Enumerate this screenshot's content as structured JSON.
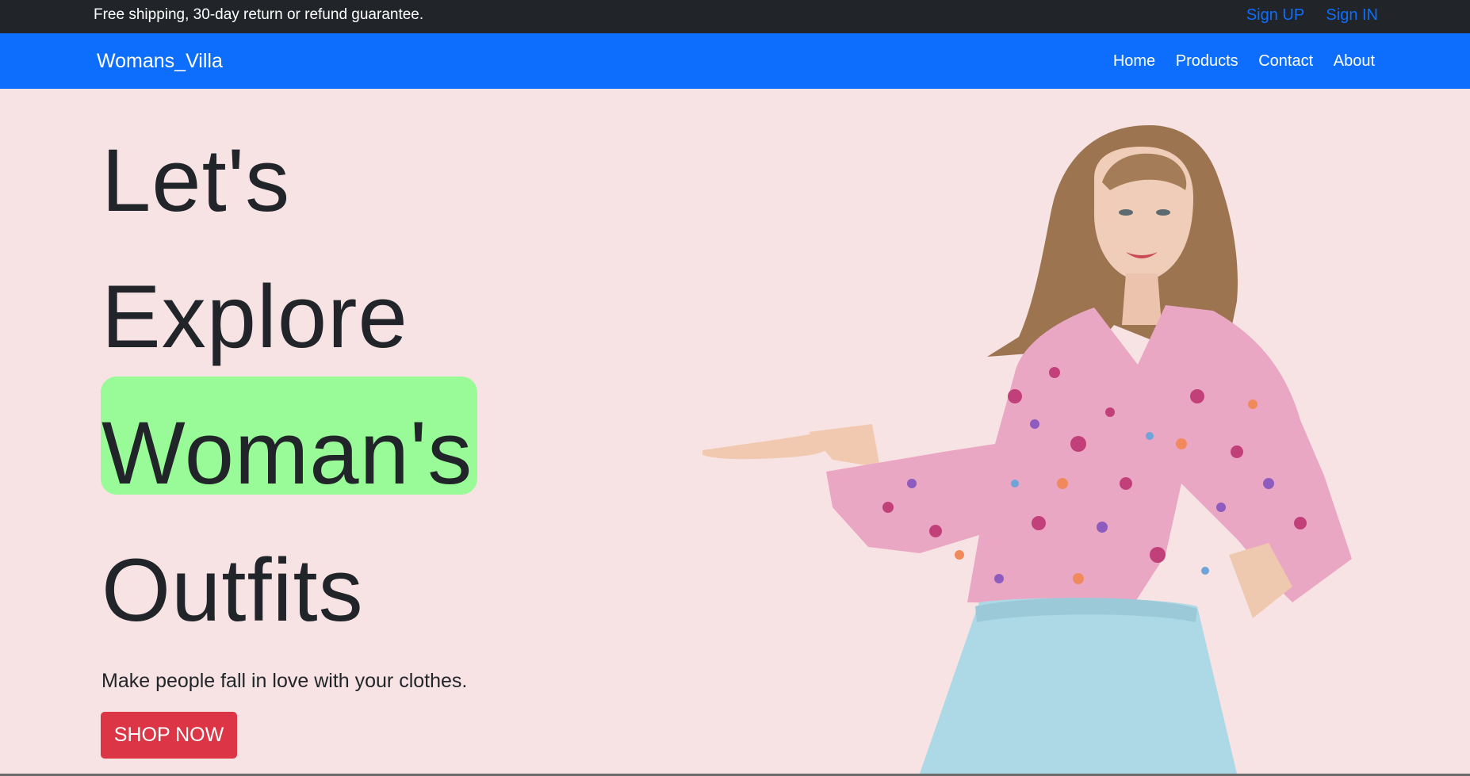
{
  "topbar": {
    "notice": "Free shipping, 30-day return or refund guarantee.",
    "sign_up": "Sign UP",
    "sign_in": "Sign IN"
  },
  "navbar": {
    "brand": "Womans_Villa",
    "links": [
      "Home",
      "Products",
      "Contact",
      "About"
    ]
  },
  "hero": {
    "headline": [
      "Let's",
      "Explore",
      "Woman's",
      "Outfits"
    ],
    "tagline": "Make people fall in love with your clothes.",
    "cta": "SHOP NOW"
  },
  "colors": {
    "topbar_bg": "#212529",
    "navbar_bg": "#0d6efd",
    "hero_bg": "#f8e3e4",
    "highlight": "#98fb98",
    "cta_bg": "#dc3545",
    "link": "#0d6efd"
  }
}
